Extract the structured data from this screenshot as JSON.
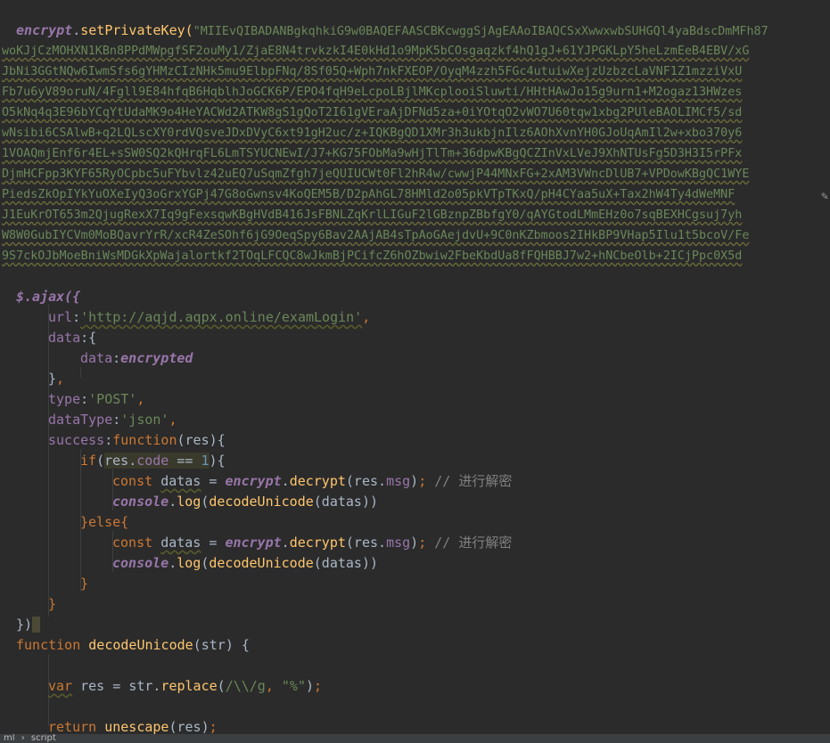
{
  "editor": {
    "key_call": {
      "obj": "encrypt",
      "dot": ".",
      "method": "setPrivateKey",
      "open": "(",
      "first_chunk": "\"MIIEvQIBADANBgkqhkiG9w0BAQEFAASCBKcwggSjAgEAAoIBAQCSxXwwxwbSUHGQl4yaBdscDmMFh87"
    },
    "key_lines": [
      "woKJjCzMOHXN1KBn8PPdMWpgfSF2ouMy1/ZjaE8N4trvkzkI4E0kHd1o9MpK5bCOsgaqzkf4hQ1gJ+61YJPGKLpY5heLzmEeB4EBV/xG",
      "JbNi3GGtNQw6IwmSfs6gYHMzCIzNHk5mu9ElbpFNq/8Sf05Q+Wph7nkFXEOP/OyqM4zzh5FGc4utuiwXejzUzbzcLaVNF1Z1mzziVxU",
      "Fb7u6yV89oruN/4Fgll9E84hfqB6HqblhJoGCK6P/EPO4fqH9eLcpoLBjlMKcplooiSluwti/HHtHAwJo15g9urn1+M2ogaz13HWzes",
      "O5kNq4q3E96bYCqYtUdaMK9o4HeYACWd2ATKW8gS1gQoT2I61gVEraAjDFNd5za+0iYOtqO2vWO7U60tqw1xbg2PUleBAOLIMCf5/sd",
      "wNsibi6CSAlwB+q2LQLscXY0rdVQsveJDxDVyC6xt91gH2uc/z+IQKBgQD1XMr3h3ukbjnIlz6AOhXvnYH0GJoUqAmIl2w+xbo370y6",
      "1VOAQmjEnf6r4EL+sSW0SQ2kQHrqFL6LmTSYUCNEwI/J7+KG75FObMa9wHjTlTm+36dpwKBgQCZInVxLVeJ9XhNTUsFg5D3H3I5rPFx",
      "DjmHCFpp3KYF65RyOCpbc5uFYbvlz42uEQ7uSqmZfgh7jeQUIUCWt0Fl2hR4w/cwwjP44MNxFG+2xAM3VWncDlUB7+VPDowKBgQC1WYE",
      "PiedsZkOpIYkYuOXeIyQ3oGrxYGPj47G8oGwnsv4KoQEM5B/D2pAhGL78HMld2o05pkVTpTKxQ/pH4CYaa5uX+Tax2hW4Ty4dWeMNF",
      "J1EuKrOT653m2QjugRexX7Iq9gFexsqwKBgHVdB416JsFBNLZqKrlLIGuF2lGBznpZBbfgY0/qAYGtodLMmEHz0o7sqBEXHCgsuj7yh",
      "W8W0GubIYCVm0MoBQavrYrR/xcR4ZeSOhf6jG9OeqSpy6Bav2AAjAB4sTpAoGAejdvU+9C0nKZbmoos2IHkBP9VHap5Ilu1t5bcoV/Fe",
      "9S7ckOJbMoeBniWsMDGkXpWajalortkf2TOqLFCQC8wJkmBjPCifcZ6hOZbwiw2FbeKbdUa8fFQHBBJ7w2+hNCbeOlb+2ICjPpc0X5d"
    ],
    "ajax": {
      "open": "$.ajax({",
      "url_key": "url",
      "url_value": "'http://aqjd.aqpx.online/examLogin'",
      "data_key": "data",
      "data_inner_key": "data",
      "data_inner_value": "encrypted",
      "type_key": "type",
      "type_value": "'POST'",
      "datatype_key": "dataType",
      "datatype_value": "'json'",
      "success_key": "success",
      "function_kw": "function",
      "param": "res",
      "if_kw": "if",
      "cond_obj": "res",
      "cond_prop": "code",
      "cond_op": " == ",
      "cond_num": "1",
      "const_kw": "const",
      "var_name": "datas",
      "decrypt_obj": "encrypt",
      "decrypt_fn": "decrypt",
      "msg_prop": "msg",
      "comment": "// 进行解密",
      "console": "console",
      "log_fn": "log",
      "decode_fn": "decodeUnicode",
      "else_kw": "}else{",
      "close": "})"
    },
    "decode_func": {
      "function_kw": "function",
      "name": "decodeUnicode",
      "param": "str",
      "var_kw": "var",
      "var_name": "res",
      "str_obj": "str",
      "replace_fn": "replace",
      "regex": "/\\\\/g",
      "replacement": "\"%\"",
      "return_kw": "return",
      "unescape_fn": "unescape"
    }
  },
  "statusbar": {
    "left": "ml",
    "crumb": "script"
  },
  "colors": {
    "background": "#2b2b2b",
    "keyword": "#cc7832",
    "string": "#6a8759",
    "function": "#ffc66d",
    "property": "#9876aa",
    "number": "#6897bb",
    "comment": "#808080"
  },
  "icons": {
    "hint": "pencil-icon"
  }
}
